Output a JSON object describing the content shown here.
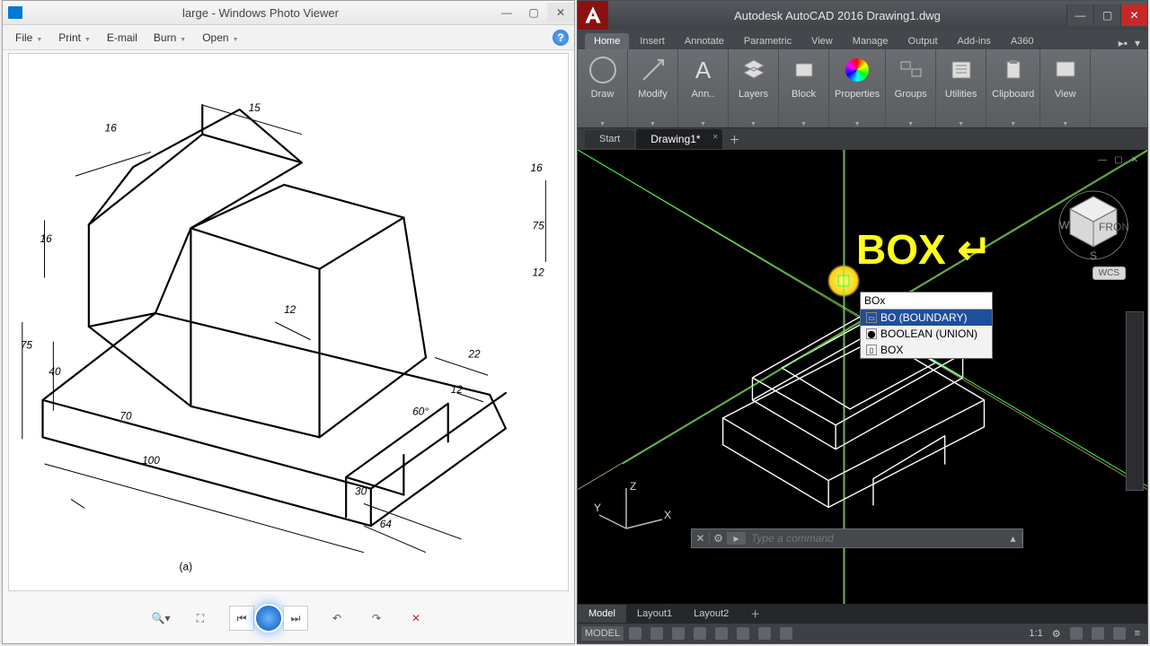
{
  "photoviewer": {
    "title": "large - Windows Photo Viewer",
    "menu": {
      "file": "File",
      "print": "Print",
      "email": "E-mail",
      "burn": "Burn",
      "open": "Open"
    },
    "drawing_label": "(a)",
    "dims": {
      "d15": "15",
      "d16a": "16",
      "d16b": "16",
      "d16c": "16",
      "d75a": "75",
      "d75b": "75",
      "d40": "40",
      "d70": "70",
      "d100": "100",
      "d12a": "12",
      "d12b": "12",
      "d12c": "12",
      "d22": "22",
      "d30": "30",
      "d64": "64",
      "a60": "60°"
    }
  },
  "autocad": {
    "title": "Autodesk AutoCAD 2016     Drawing1.dwg",
    "tabs": [
      "Home",
      "Insert",
      "Annotate",
      "Parametric",
      "View",
      "Manage",
      "Output",
      "Add-ins",
      "A360"
    ],
    "active_tab": "Home",
    "panels": [
      "Draw",
      "Modify",
      "Ann..",
      "Layers",
      "Block",
      "Properties",
      "Groups",
      "Utilities",
      "Clipboard",
      "View"
    ],
    "file_tabs": {
      "start": "Start",
      "drawing": "Drawing1*"
    },
    "overlay": "BOX ↵",
    "cmd_input": "BOx",
    "cmd_items": [
      {
        "label": "BO (BOUNDARY)",
        "sel": true
      },
      {
        "label": "BOOLEAN (UNION)",
        "sel": false
      },
      {
        "label": "BOX",
        "sel": false
      }
    ],
    "wcs": "WCS",
    "ucs": {
      "x": "X",
      "y": "Y",
      "z": "Z"
    },
    "cmdline_placeholder": "Type a command",
    "layouts": [
      "Model",
      "Layout1",
      "Layout2"
    ],
    "status": {
      "model": "MODEL",
      "ratio": "1:1"
    }
  }
}
